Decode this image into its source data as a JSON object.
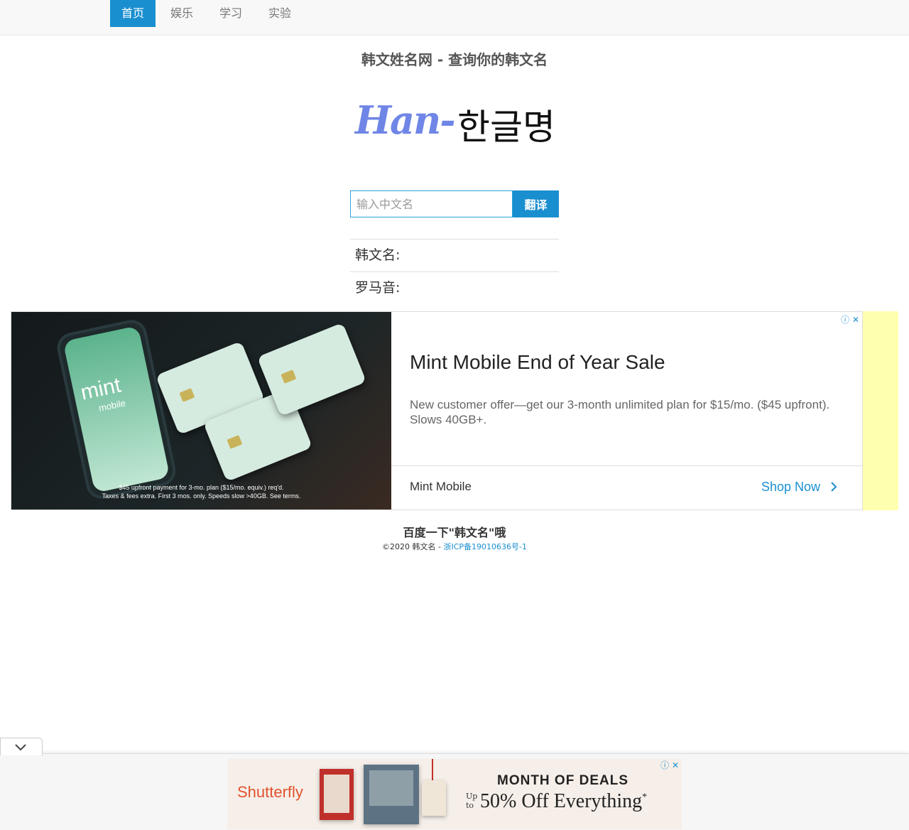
{
  "nav": {
    "items": [
      {
        "label": "首页",
        "active": true
      },
      {
        "label": "娱乐",
        "active": false
      },
      {
        "label": "学习",
        "active": false
      },
      {
        "label": "实验",
        "active": false
      }
    ]
  },
  "header": {
    "title": "韩文姓名网 - 查询你的韩文名"
  },
  "logo": {
    "latin": "Han-",
    "korean": "한글명"
  },
  "search": {
    "placeholder": "输入中文名",
    "value": "",
    "button_label": "翻译"
  },
  "results": {
    "korean_label": "韩文名:",
    "romanization_label": "罗马音:"
  },
  "ad": {
    "image_brand": "mint",
    "image_brand_sub": "mobile",
    "disclaimer_line1": "$45 upfront payment for 3-mo. plan ($15/mo. equiv.) req'd.",
    "disclaimer_line2": "Taxes & fees extra. First 3 mos. only. Speeds slow >40GB. See terms.",
    "headline": "Mint Mobile End of Year Sale",
    "description": "New customer offer—get our 3-month unlimited plan for $15/mo. ($45 upfront). Slows 40GB+.",
    "advertiser": "Mint Mobile",
    "cta": "Shop Now",
    "accent_color": "#1a8fd0"
  },
  "footer": {
    "slogan": "百度一下\"韩文名\"哦",
    "copyright": "©2020 韩文名 - ",
    "icp_link": "浙ICP备19010636号-1"
  },
  "anchor_ad": {
    "brand": "Shutterfly",
    "headline": "MONTH OF DEALS",
    "upto_line1": "Up",
    "upto_line2": "to",
    "offer": "50% Off Everything",
    "offer_mark": "*"
  },
  "colors": {
    "primary": "#1a8fd0",
    "nav_bg": "#f8f8f8",
    "logo_blue": "#6f86e6",
    "ad_side": "#ffffb0"
  }
}
